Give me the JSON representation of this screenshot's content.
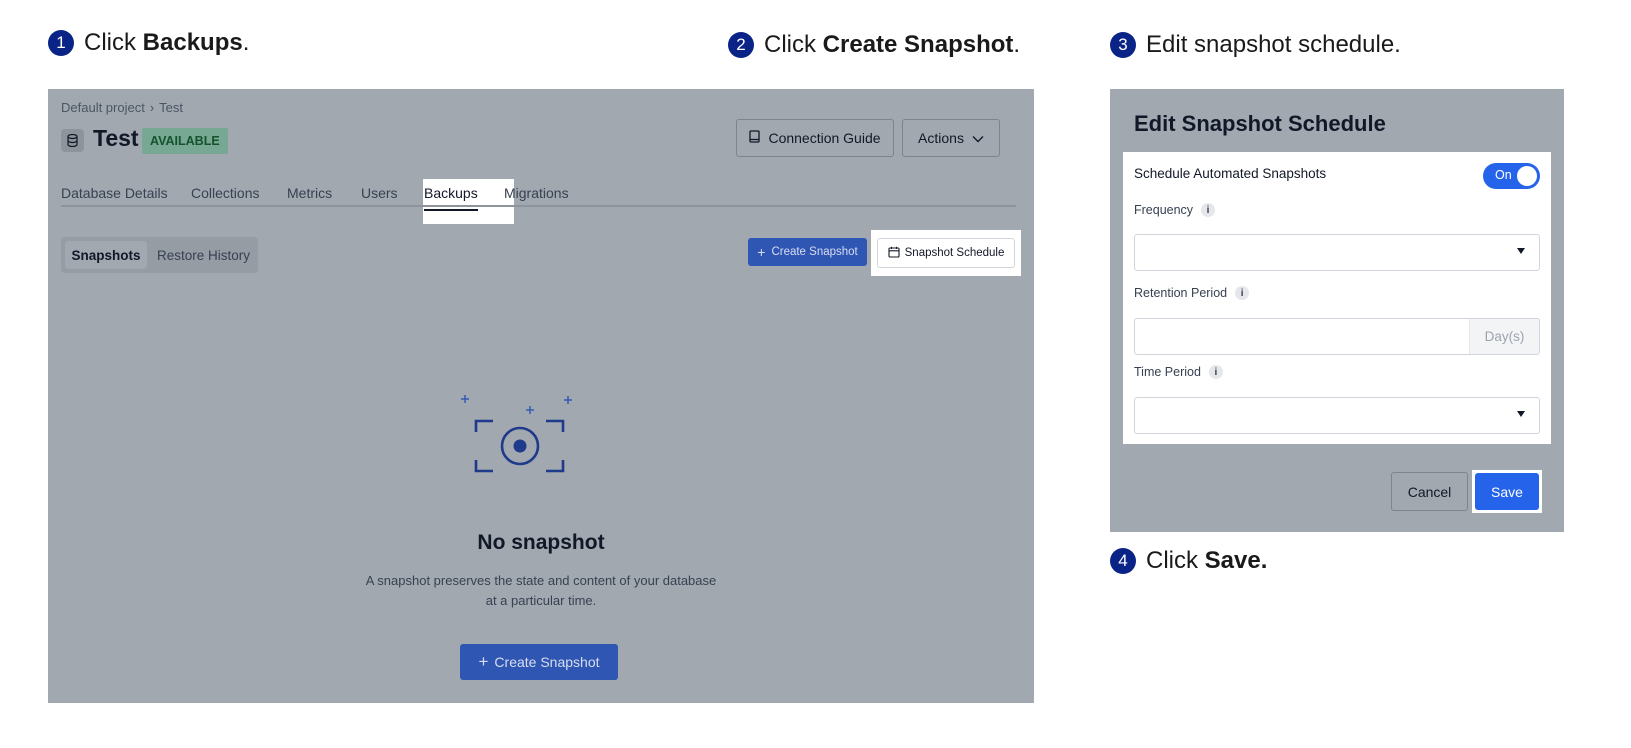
{
  "steps": [
    {
      "number": "1",
      "prefix": "Click ",
      "bold": "Backups",
      "suffix": "."
    },
    {
      "number": "2",
      "prefix": "Click ",
      "bold": "Create Snapshot",
      "suffix": "."
    },
    {
      "number": "3",
      "prefix": "Edit snapshot schedule.",
      "bold": "",
      "suffix": ""
    },
    {
      "number": "4",
      "prefix": "Click ",
      "bold": "Save.",
      "suffix": ""
    }
  ],
  "database_page": {
    "breadcrumb": {
      "project": "Default project",
      "separator": "›",
      "current": "Test"
    },
    "title": "Test",
    "status": "AVAILABLE",
    "connection_guide_label": "Connection Guide",
    "actions_label": "Actions",
    "tabs": [
      "Database Details",
      "Collections",
      "Metrics",
      "Users",
      "Backups",
      "Migrations"
    ],
    "active_tab": "Backups",
    "subtabs": [
      "Snapshots",
      "Restore History"
    ],
    "create_snapshot_label": "Create Snapshot",
    "snapshot_schedule_label": "Snapshot Schedule",
    "empty_state": {
      "title": "No snapshot",
      "description_line1": "A snapshot preserves the state and content of your database",
      "description_line2": "at a particular time.",
      "button_label": "Create Snapshot"
    }
  },
  "schedule_dialog": {
    "title": "Edit Snapshot Schedule",
    "toggle_label": "Schedule Automated Snapshots",
    "toggle_state": "On",
    "frequency_label": "Frequency",
    "frequency_value": "",
    "retention_label": "Retention Period",
    "retention_value": "",
    "retention_unit": "Day(s)",
    "time_period_label": "Time Period",
    "time_period_value": "",
    "info_glyph": "i",
    "cancel_label": "Cancel",
    "save_label": "Save"
  },
  "colors": {
    "step_badge": "#0a2387",
    "overlay": "#a1a8b0",
    "primary_button": "#2563eb",
    "status_badge": "#76a893"
  }
}
